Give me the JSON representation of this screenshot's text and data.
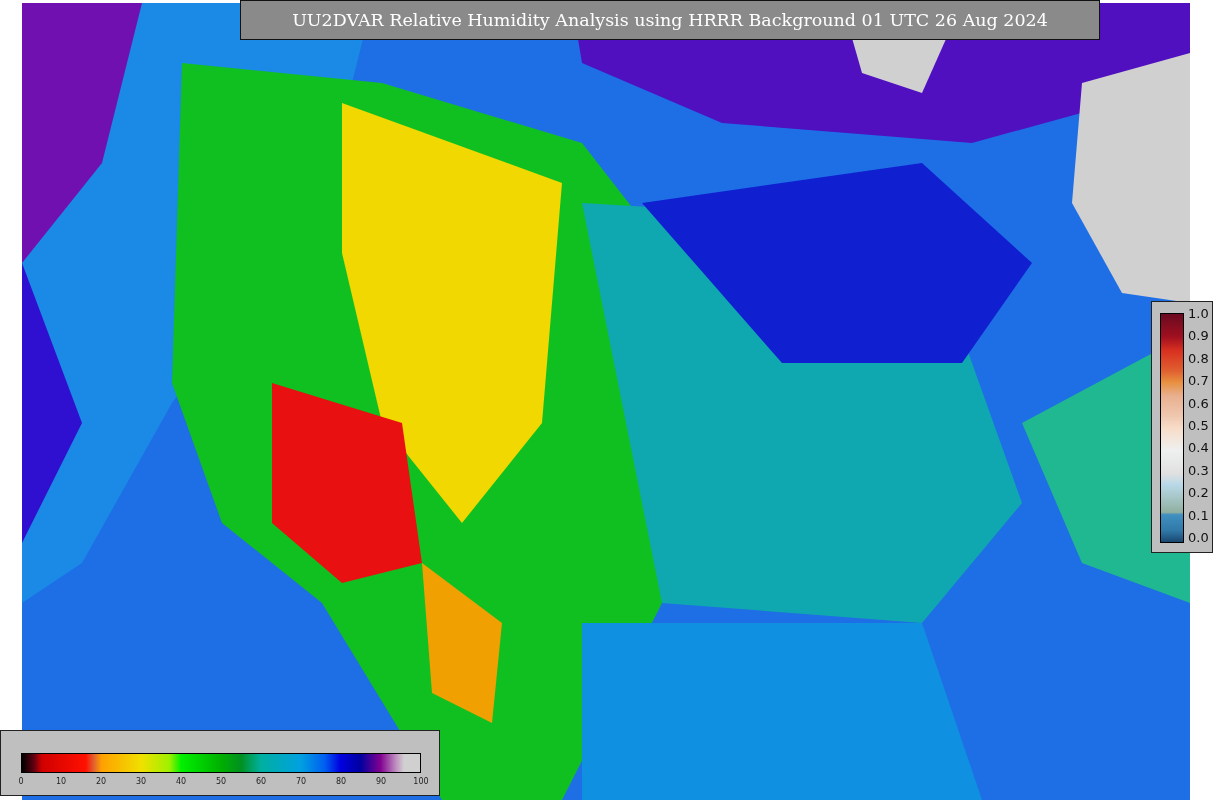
{
  "title": "UU2DVAR Relative Humidity Analysis using HRRR Background 01 UTC 26 Aug 2024",
  "humidity_scale": {
    "ticks": [
      "0",
      "10",
      "20",
      "30",
      "40",
      "50",
      "60",
      "70",
      "80",
      "90",
      "100"
    ]
  },
  "observation_scale": {
    "ticks": [
      "1.0",
      "0.9",
      "0.8",
      "0.7",
      "0.6",
      "0.5",
      "0.4",
      "0.3",
      "0.2",
      "0.1",
      "0.0"
    ]
  }
}
